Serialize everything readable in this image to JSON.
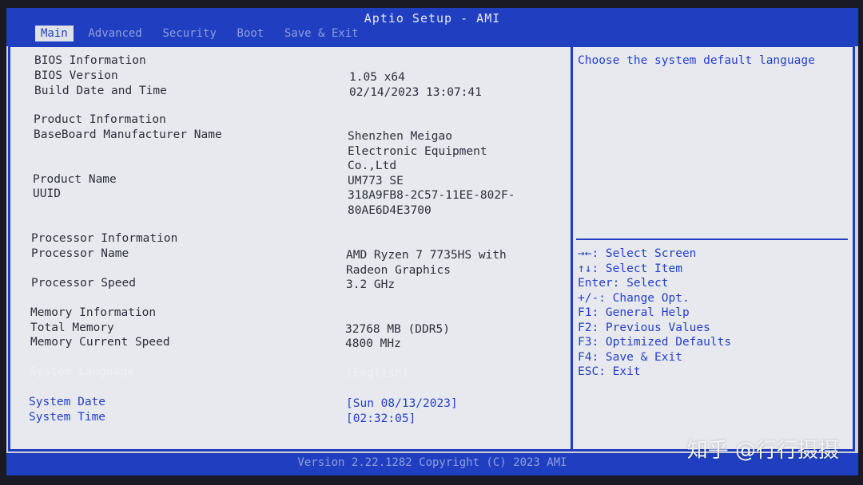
{
  "title": "Aptio Setup - AMI",
  "tabs": [
    "Main",
    "Advanced",
    "Security",
    "Boot",
    "Save & Exit"
  ],
  "main": {
    "bios_info_heading": "BIOS Information",
    "bios_version_label": "BIOS Version",
    "bios_version_value": "1.05 x64",
    "build_date_label": "Build Date and Time",
    "build_date_value": "02/14/2023 13:07:41",
    "product_info_heading": "Product Information",
    "baseboard_label": "BaseBoard Manufacturer Name",
    "baseboard_value_1": "Shenzhen Meigao",
    "baseboard_value_2": "Electronic Equipment",
    "baseboard_value_3": "Co.,Ltd",
    "product_name_label": "Product Name",
    "product_name_value": "UM773 SE",
    "uuid_label": "UUID",
    "uuid_value_1": "318A9FB8-2C57-11EE-802F-",
    "uuid_value_2": "80AE6D4E3700",
    "processor_info_heading": "Processor Information",
    "processor_name_label": "Processor Name",
    "processor_name_value_1": "AMD Ryzen 7 7735HS with",
    "processor_name_value_2": "Radeon Graphics",
    "processor_speed_label": "Processor Speed",
    "processor_speed_value": "3.2 GHz",
    "memory_info_heading": "Memory Information",
    "total_memory_label": "Total Memory",
    "total_memory_value": "32768 MB (DDR5)",
    "memory_speed_label": "Memory Current Speed",
    "memory_speed_value": "4800 MHz",
    "system_language_label": "System Language",
    "system_language_value": "[English]",
    "system_date_label": "System Date",
    "system_date_value": "[Sun 08/13/2023]",
    "system_time_label": "System Time",
    "system_time_value": "[02:32:05]"
  },
  "help": {
    "description": "Choose the system default language",
    "keys": [
      "→←: Select Screen",
      "↑↓: Select Item",
      "Enter: Select",
      "+/-: Change Opt.",
      "F1: General Help",
      "F2: Previous Values",
      "F3: Optimized Defaults",
      "F4: Save & Exit",
      "ESC: Exit"
    ]
  },
  "footer": "Version 2.22.1282 Copyright (C) 2023 AMI",
  "watermark": "知乎 @行行摄摄",
  "colors": {
    "bar": "#1f3fc0",
    "panel": "#e7e9ee",
    "accent": "#2440c8"
  }
}
